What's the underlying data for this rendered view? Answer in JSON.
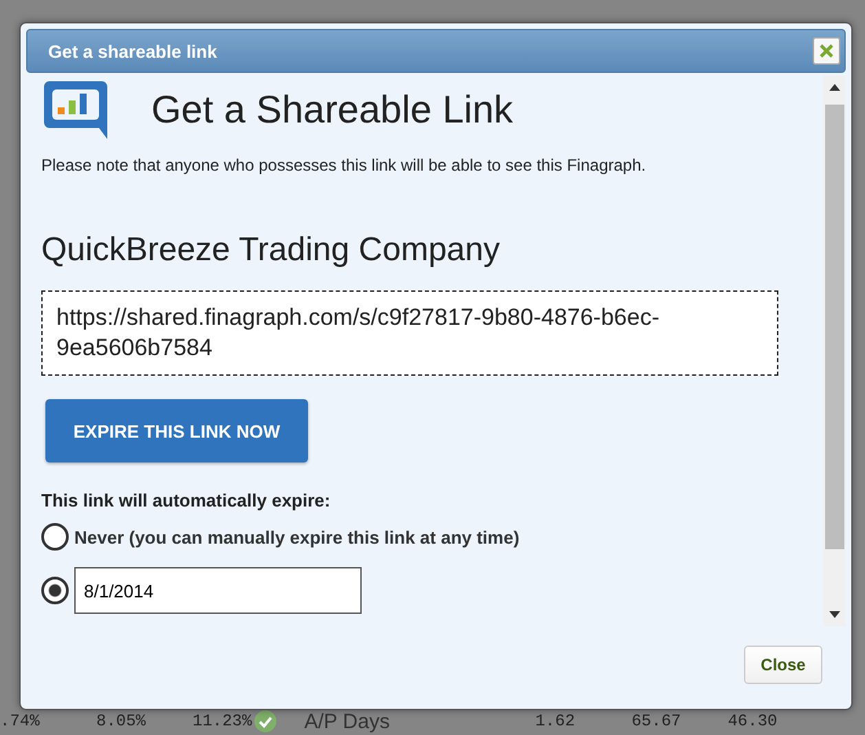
{
  "background_row": {
    "cells": [
      ".74%",
      "8.05%",
      "11.23%"
    ],
    "check": true,
    "label": "A/P Days",
    "values": [
      "1.62",
      "65.67",
      "46.30"
    ]
  },
  "dialog": {
    "title": "Get a shareable link",
    "heading": "Get a Shareable Link",
    "note": "Please note that anyone who possesses this link will be able to see this Finagraph.",
    "company": "QuickBreeze Trading Company",
    "link": "https://shared.finagraph.com/s/c9f27817-9b80-4876-b6ec-9ea5606b7584",
    "expire_button": "EXPIRE THIS LINK NOW",
    "expire_label": "This link will automatically expire:",
    "options": [
      {
        "kind": "text",
        "label": "Never (you can manually expire this link at any time)",
        "selected": false
      },
      {
        "kind": "date",
        "value": "8/1/2014",
        "selected": true
      }
    ],
    "close_button": "Close"
  }
}
